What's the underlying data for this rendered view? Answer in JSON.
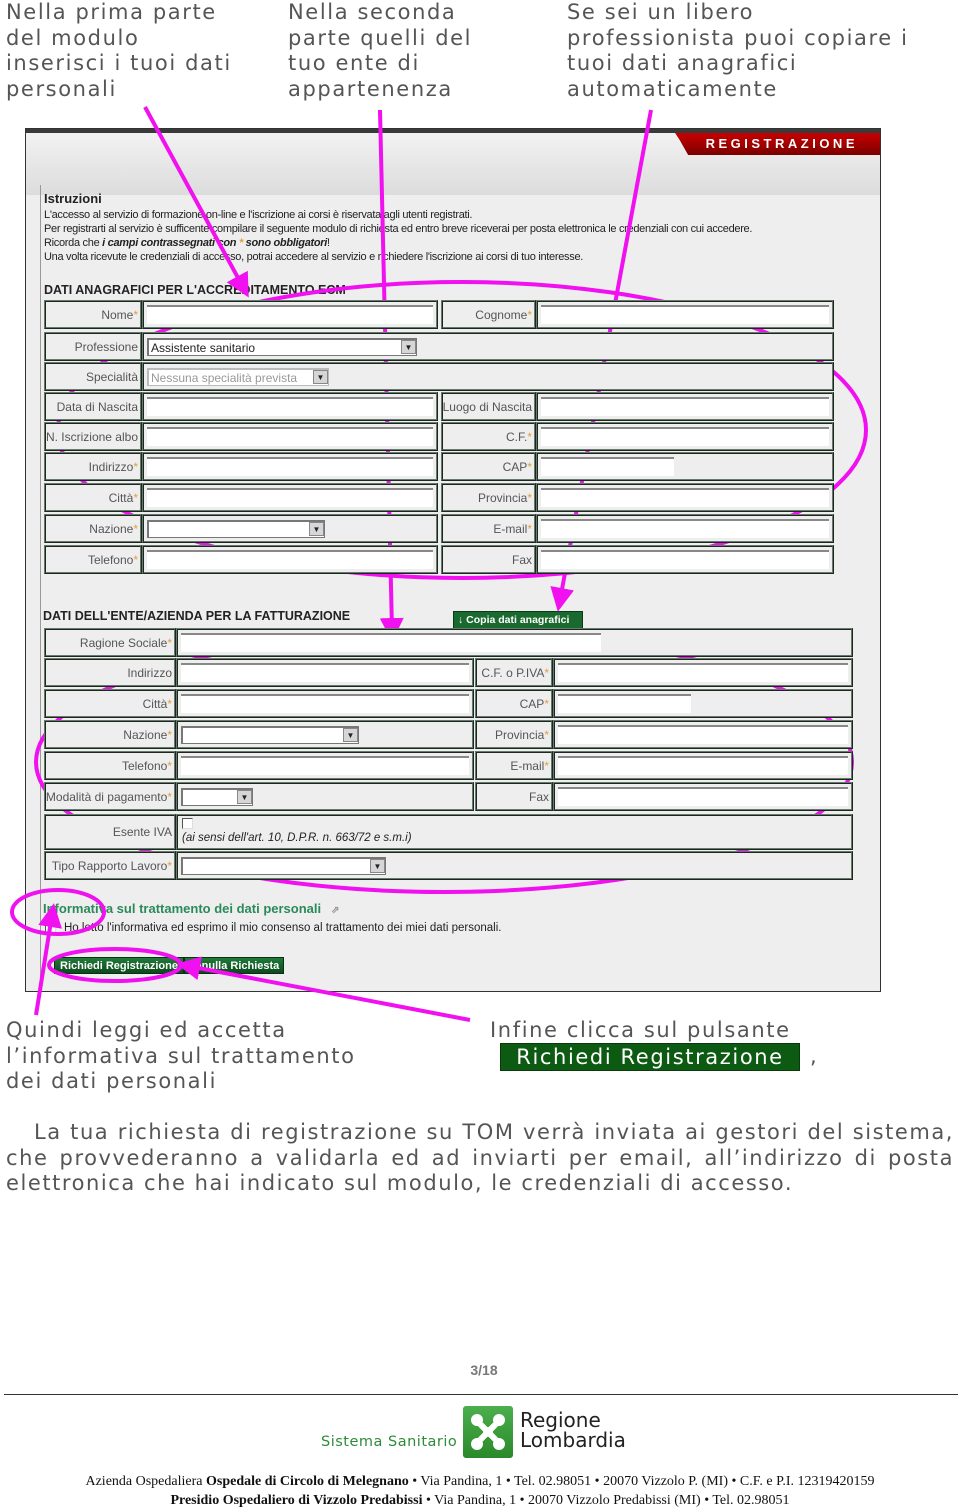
{
  "callouts": {
    "top_left": "Nella prima parte\ndel modulo\ninserisci i tuoi dati\npersonali",
    "top_middle": "Nella seconda\nparte quelli del\ntuo ente di\nappartenenza",
    "top_right": "Se sei un libero\nprofessionista puoi copiare i\ntuoi dati anagrafici\nautomaticamente",
    "bottom_left": "Quindi leggi ed accetta\nl’informativa sul trattamento\ndei dati personali",
    "bottom_right": "Infine clicca sul pulsante",
    "bottom_right_button": "Richiedi Registrazione",
    "bottom_right_comma": ","
  },
  "screenshot": {
    "header_tab": "REGISTRAZIONE",
    "instructions": {
      "title": "Istruzioni",
      "line1": "L'accesso al servizio di formazione on-line e l'iscrizione ai corsi è riservata agli utenti registrati.",
      "line2": "Per registrarti al servizio è sufficente compilare il seguente modulo di richiesta ed entro breve riceverai per posta elettronica le credenziali con cui accedere.",
      "line3_pre": "Ricorda che ",
      "line3_bold": "i campi contrassegnati con ",
      "line3_star": "*",
      "line3_bold2": " sono obbligatori",
      "line3_post": "!",
      "line4": "Una volta ricevute le credenziali di accesso, potrai accedere al servizio e richiedere l'iscrizione ai corsi di tuo interesse."
    },
    "personal_section": {
      "title": "DATI ANAGRAFICI PER L'ACCREDITAMENTO ECM",
      "nome": "Nome",
      "cognome": "Cognome",
      "professione": "Professione",
      "professione_value": "Assistente sanitario",
      "specialita": "Specialità",
      "specialita_value": "Nessuna specialità prevista",
      "data_nascita": "Data di Nascita",
      "luogo_nascita": "Luogo di Nascita",
      "iscrizione_albo": "N. Iscrizione albo",
      "cf": "C.F.",
      "indirizzo": "Indirizzo",
      "cap": "CAP",
      "citta": "Città",
      "provincia": "Provincia",
      "nazione": "Nazione",
      "email": "E-mail",
      "telefono": "Telefono",
      "fax": "Fax",
      "required_mark": "*"
    },
    "billing_section": {
      "title": "DATI DELL'ENTE/AZIENDA PER LA FATTURAZIONE",
      "copy_button": "↓ Copia dati anagrafici",
      "ragione_sociale": "Ragione Sociale",
      "indirizzo": "Indirizzo",
      "cf_piva": "C.F. o P.IVA",
      "citta": "Città",
      "cap": "CAP",
      "nazione": "Nazione",
      "provincia": "Provincia",
      "telefono": "Telefono",
      "email": "E-mail",
      "modalita_pagamento": "Modalità di pagamento",
      "fax": "Fax",
      "esente_iva": "Esente IVA",
      "esente_iva_note": "(ai sensi dell'art. 10, D.P.R. n. 663/72 e s.m.i)",
      "tipo_rapporto": "Tipo Rapporto Lavoro",
      "required_mark": "*"
    },
    "privacy_link": "Informativa sul trattamento dei dati personali",
    "consent_label": "Ho letto l'informativa ed esprimo il mio consenso al trattamento dei miei dati personali.",
    "submit_button": "Richiedi Registrazione",
    "cancel_button": "Annulla Richiesta"
  },
  "paragraph": "La tua richiesta di registrazione su TOM verrà inviata ai gestori del sistema, che provvederanno a validarla ed ad inviarti per email, all’indirizzo di posta elettronica che hai indicato sul modulo, le credenziali di accesso.",
  "footer": {
    "page_number": "3/18",
    "logo_left": "Sistema Sanitario",
    "logo_right_line1": "Regione",
    "logo_right_line2": "Lombardia",
    "line1_pre": "Azienda Ospedaliera ",
    "line1_bold": "Ospedale di Circolo di Melegnano",
    "line1_post": " • Via Pandina, 1 • Tel. 02.98051 • 20070 Vizzolo P. (MI) • C.F. e P.I. 12319420159",
    "line2_bold": "Presidio Ospedaliero di Vizzolo Predabissi",
    "line2_post": " • Via Pandina, 1 • 20070 Vizzolo Predabissi (MI) • Tel. 02.98051"
  },
  "colors": {
    "annotation_magenta": "#f010f0",
    "button_green": "#0d5a12",
    "header_red": "#b00000",
    "link_green": "#2b8a5a"
  }
}
